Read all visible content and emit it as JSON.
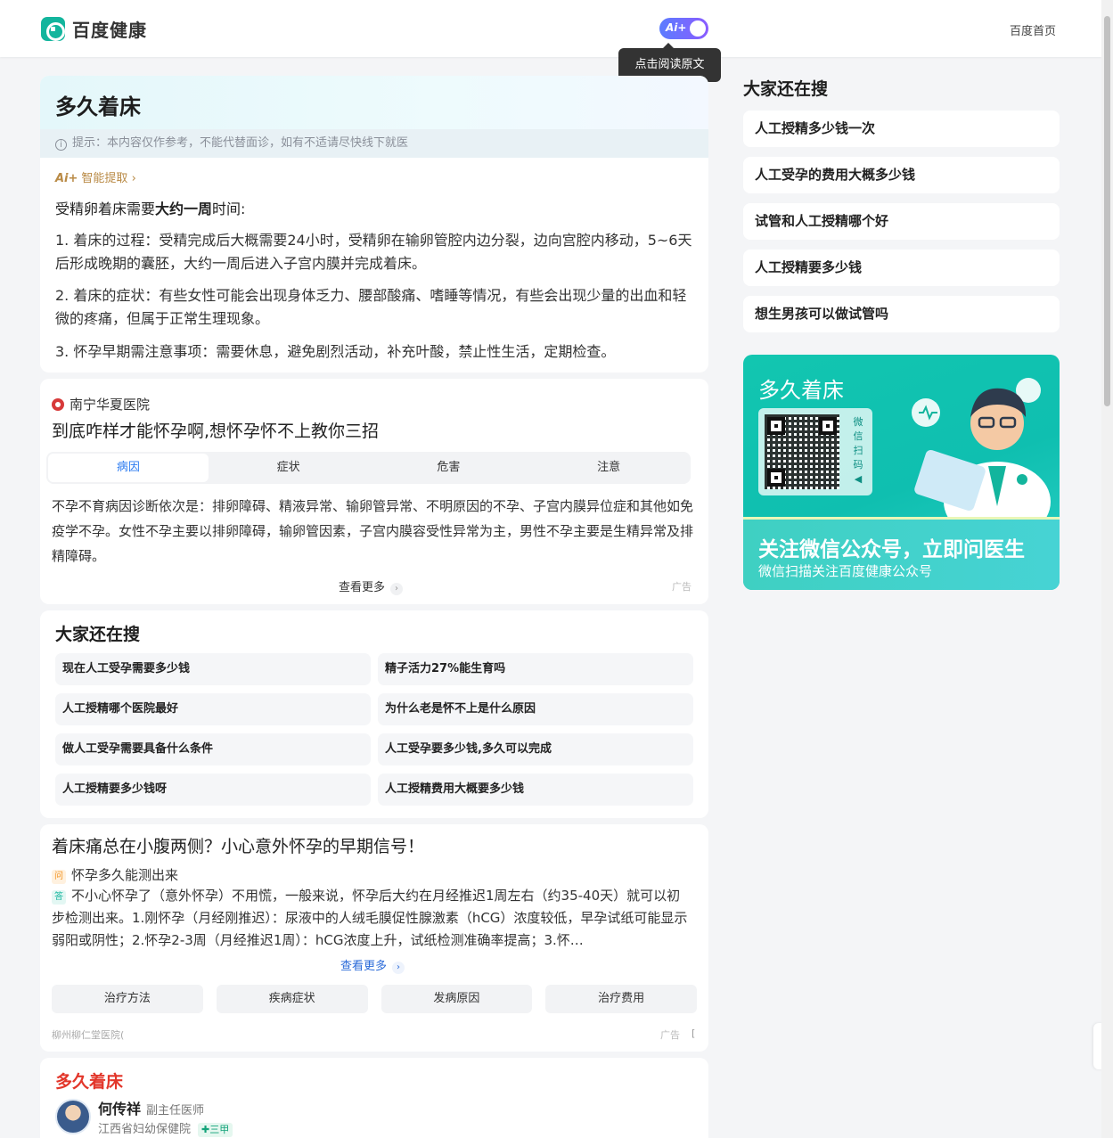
{
  "header": {
    "logo_text": "百度健康",
    "ai_toggle_label": "Ai+",
    "tooltip": "点击阅读原文",
    "home_link": "百度首页"
  },
  "summary": {
    "title": "多久着床",
    "notice_icon": "i",
    "notice": "提示：本内容仅作参考，不能代替面诊，如有不适请尽快线下就医",
    "ai_mini": "Ai+",
    "ai_extract": "智能提取",
    "lead_prefix": "受精卵着床需要",
    "lead_bold": "大约一周",
    "lead_suffix": "时间:",
    "points": [
      "1. 着床的过程：受精完成后大概需要24小时，受精卵在输卵管腔内边分裂，边向宫腔内移动，5~6天后形成晚期的囊胚，大约一周后进入子宫内膜并完成着床。",
      "2. 着床的症状：有些女性可能会出现身体乏力、腰部酸痛、嗜睡等情况，有些会出现少量的出血和轻微的疼痛，但属于正常生理现象。",
      "3. 怀孕早期需注意事项：需要休息，避免剧烈活动，补充叶酸，禁止性生活，定期检查。"
    ]
  },
  "hospital_ad": {
    "hospital_name": "南宁华夏医院",
    "headline": "到底咋样才能怀孕啊,想怀孕怀不上教你三招",
    "tabs": [
      "病因",
      "症状",
      "危害",
      "注意"
    ],
    "active_tab": "病因",
    "body": "不孕不育病因诊断依次是：排卵障碍、精液异常、输卵管异常、不明原因的不孕、子宫内膜异位症和其他如免疫学不孕。女性不孕主要以排卵障碍，输卵管因素，子宫内膜容受性异常为主，男性不孕主要是生精异常及排精障碍。",
    "see_more": "查看更多",
    "ad_label": "广告"
  },
  "related_search": {
    "title": "大家还在搜",
    "items": [
      "现在人工受孕需要多少钱",
      "精子活力27%能生育吗",
      "人工授精哪个医院最好",
      "为什么老是怀不上是什么原因",
      "做人工受孕需要具备什么条件",
      "人工受孕要多少钱,多久可以完成",
      "人工授精要多少钱呀",
      "人工授精费用大概要多少钱"
    ]
  },
  "qa_ad": {
    "title": "着床痛总在小腹两侧？小心意外怀孕的早期信号！",
    "q_badge": "问",
    "question": "怀孕多久能测出来",
    "a_badge": "答",
    "answer": "不小心怀孕了（意外怀孕）不用慌，一般来说，怀孕后大约在月经推迟1周左右（约35-40天）就可以初步检测出来。1.刚怀孕（月经刚推迟）：尿液中的人绒毛膜促性腺激素（hCG）浓度较低，早孕试纸可能显示弱阳或阴性；2.怀孕2-3周（月经推迟1周）：hCG浓度上升，试纸检测准确率提高；3.怀…",
    "see_more": "查看更多",
    "chips": [
      "治疗方法",
      "疾病症状",
      "发病原因",
      "治疗费用"
    ],
    "source": "柳州柳仁堂医院(",
    "ad_label": "广告",
    "ad_bracket": "["
  },
  "doctor": {
    "heading": "多久着床",
    "name": "何传祥",
    "role": "副主任医师",
    "institution": "江西省妇幼保健院",
    "tier": "三甲"
  },
  "sidebar": {
    "title": "大家还在搜",
    "items": [
      "人工授精多少钱一次",
      "人工受孕的费用大概多少钱",
      "试管和人工授精哪个好",
      "人工授精要多少钱",
      "想生男孩可以做试管吗"
    ]
  },
  "promo": {
    "title": "多久着床",
    "qr_side_text": "微信扫码",
    "band_title": "关注微信公众号，立即问医生",
    "band_sub": "微信扫描关注百度健康公众号"
  },
  "colors": {
    "brand_teal": "#13b59d",
    "link_blue": "#2a7af0",
    "heading_red": "#e2362a"
  }
}
